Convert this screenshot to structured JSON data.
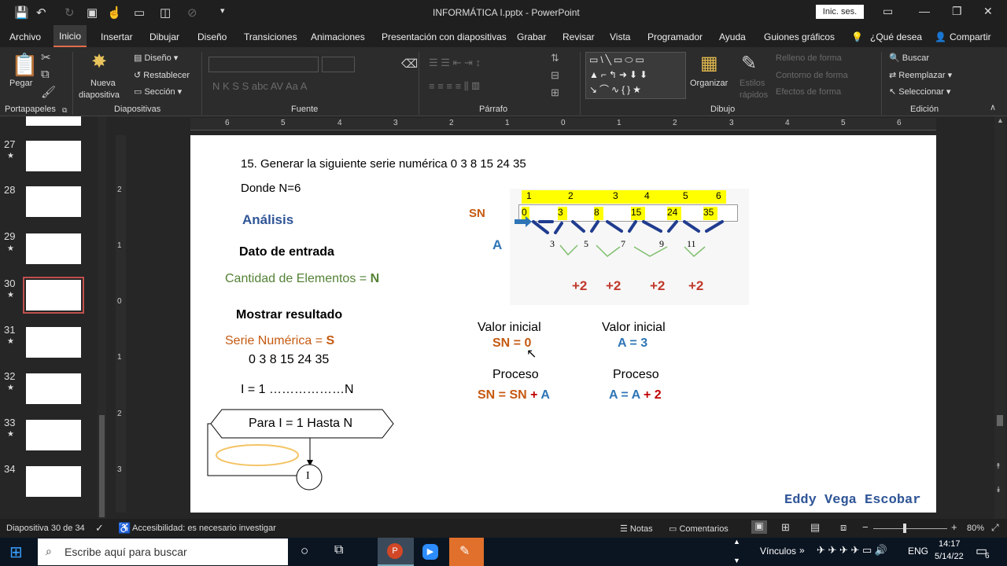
{
  "window": {
    "doc_title": "INFORMÁTICA I.pptx  -  PowerPoint",
    "signin_label": "Inic. ses."
  },
  "tabs": [
    "Archivo",
    "Inicio",
    "Insertar",
    "Dibujar",
    "Diseño",
    "Transiciones",
    "Animaciones",
    "Presentación con diapositivas",
    "Grabar",
    "Revisar",
    "Vista",
    "Programador",
    "Ayuda",
    "Guiones gráficos"
  ],
  "search_tab": "¿Qué desea",
  "share_label": "Compartir",
  "ribbon": {
    "paste": "Pegar",
    "new_slide_1": "Nueva",
    "new_slide_2": "diapositiva",
    "layout": "Diseño",
    "reset": "Restablecer",
    "section": "Sección",
    "arrange": "Organizar",
    "quick_styles_1": "Estilos",
    "quick_styles_2": "rápidos",
    "shape_fill": "Relleno de forma",
    "shape_outline": "Contorno de forma",
    "shape_effects": "Efectos de forma",
    "find": "Buscar",
    "replace": "Reemplazar",
    "select": "Seleccionar",
    "groups": {
      "clipboard": "Portapapeles",
      "slides": "Diapositivas",
      "font": "Fuente",
      "paragraph": "Párrafo",
      "drawing": "Dibujo",
      "editing": "Edición"
    }
  },
  "ruler_top": [
    "6",
    "5",
    "4",
    "3",
    "2",
    "1",
    "0",
    "1",
    "2",
    "3",
    "4",
    "5",
    "6"
  ],
  "ruler_left": [
    "2",
    "1",
    "0",
    "1",
    "2",
    "3"
  ],
  "thumbnails": [
    {
      "num": "27",
      "star": "★"
    },
    {
      "num": "28",
      "star": ""
    },
    {
      "num": "29",
      "star": "★"
    },
    {
      "num": "30",
      "star": "★"
    },
    {
      "num": "31",
      "star": "★"
    },
    {
      "num": "32",
      "star": "★"
    },
    {
      "num": "33",
      "star": "★"
    },
    {
      "num": "34",
      "star": ""
    }
  ],
  "slide": {
    "problem": "15. Generar la siguiente serie numérica 0 3 8 15 24 35",
    "donde": "Donde N=6",
    "analysis": "Análisis",
    "input_title": "Dato de entrada",
    "input_value_label": "Cantidad de Elementos = ",
    "input_value_var": "N",
    "output_title": "Mostrar resultado",
    "output_label": "Serie Numérica = ",
    "output_var": "S",
    "output_series": "0 3 8 15 24 35",
    "loop_range": "I = 1 ………………N",
    "loop_box": "Para I = 1 Hasta N",
    "loop_node": "I",
    "diagram": {
      "indices": [
        "1",
        "2",
        "3",
        "4",
        "5",
        "6"
      ],
      "sn_label": "SN",
      "sn_values": [
        "0",
        "3",
        "8",
        "15",
        "24",
        "35"
      ],
      "a_label": "A",
      "a_values": [
        "3",
        "5",
        "7",
        "9",
        "11"
      ],
      "increments": [
        "+2",
        "+2",
        "+2",
        "+2"
      ]
    },
    "sn_init_title": "Valor inicial",
    "sn_init": "SN = 0",
    "a_init_title": "Valor inicial",
    "a_init": "A = 3",
    "sn_proc_title": "Proceso",
    "sn_proc_a": "SN = SN ",
    "sn_proc_b": "+ ",
    "sn_proc_c": "A",
    "a_proc_title": "Proceso",
    "a_proc_a": "A = A ",
    "a_proc_b": "+ 2",
    "author": "Eddy Vega Escobar"
  },
  "status": {
    "slide_count": "Diapositiva 30 de 34",
    "accessibility": "Accesibilidad: es necesario investigar",
    "notes": "Notas",
    "comments": "Comentarios",
    "zoom": "80%"
  },
  "taskbar": {
    "search_placeholder": "Escribe aquí para buscar",
    "links": "Vínculos",
    "lang": "ENG",
    "time": "14:17",
    "date": "5/14/22",
    "notif_count": "6"
  },
  "colors": {
    "accent": "#e06c4c",
    "sn_orange": "#c55a11",
    "a_blue": "#2e75b6",
    "green": "#548235",
    "red": "#c00000",
    "yellow": "#ffff00"
  }
}
